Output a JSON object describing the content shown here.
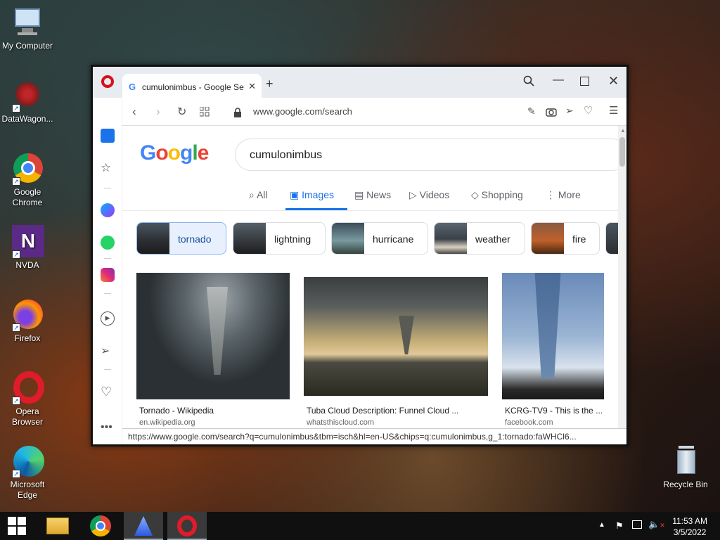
{
  "desktop": {
    "icons": [
      {
        "label": "My Computer"
      },
      {
        "label": "DataWagon..."
      },
      {
        "label": "Google Chrome"
      },
      {
        "label": "NVDA"
      },
      {
        "label": "Firefox"
      },
      {
        "label": "Opera Browser"
      },
      {
        "label": "Microsoft Edge"
      },
      {
        "label": "Recycle Bin"
      }
    ]
  },
  "browser": {
    "tab_title": "cumulonimbus - Google Se",
    "url": "www.google.com/search",
    "status_url": "https://www.google.com/search?q=cumulonimbus&tbm=isch&hl=en-US&chips=q:cumulonimbus,g_1:tornado:faWHCl6..."
  },
  "google": {
    "logo": "Google",
    "query": "cumulonimbus",
    "tabs": [
      "All",
      "Images",
      "News",
      "Videos",
      "Shopping",
      "More"
    ],
    "active_tab": "Images",
    "chips": [
      "tornado",
      "lightning",
      "hurricane",
      "weather",
      "fire"
    ],
    "results": [
      {
        "caption": "Tornado - Wikipedia",
        "source": "en.wikipedia.org"
      },
      {
        "caption": "Tuba Cloud Description: Funnel Cloud ...",
        "source": "whatsthiscloud.com"
      },
      {
        "caption": "KCRG-TV9 - This is the ...",
        "source": "facebook.com"
      }
    ]
  },
  "taskbar": {
    "time": "11:53 AM",
    "date": "3/5/2022"
  },
  "colors": {
    "opera_red": "#d6121c",
    "google_blue": "#1a73e8"
  }
}
